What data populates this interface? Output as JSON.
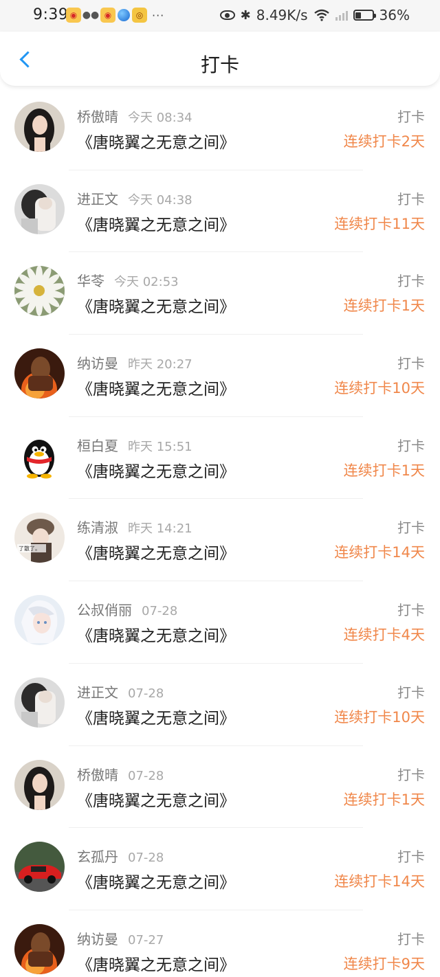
{
  "status_bar": {
    "time": "9:39",
    "network_speed": "8.49K/s",
    "battery": "36%",
    "battery_level": 0.36,
    "more_dots": "···",
    "icons": [
      "weibo-icon",
      "wechat-icon",
      "weibo-icon",
      "globe-icon",
      "app-icon",
      "eye-icon",
      "bluetooth-icon",
      "wifi-icon",
      "signal-icon",
      "battery-icon"
    ]
  },
  "header": {
    "title": "打卡",
    "back_icon": "chevron-left-icon"
  },
  "colors": {
    "accent": "#2196f3",
    "streak": "#f0874a",
    "name": "#777777",
    "time": "#a8a8a8",
    "divider": "#efefef"
  },
  "list": {
    "items": [
      {
        "name": "桥傲晴",
        "time": "今天 08:34",
        "book": "《唐晓翼之无意之间》",
        "tag": "打卡",
        "streak": "连续打卡2天",
        "avatar": "girl-portrait"
      },
      {
        "name": "进正文",
        "time": "今天 04:38",
        "book": "《唐晓翼之无意之间》",
        "tag": "打卡",
        "streak": "连续打卡11天",
        "avatar": "girl-hiding-face"
      },
      {
        "name": "华苓",
        "time": "今天 02:53",
        "book": "《唐晓翼之无意之间》",
        "tag": "打卡",
        "streak": "连续打卡1天",
        "avatar": "white-daisy"
      },
      {
        "name": "纳访曼",
        "time": "昨天 20:27",
        "book": "《唐晓翼之无意之间》",
        "tag": "打卡",
        "streak": "连续打卡10天",
        "avatar": "game-warrior"
      },
      {
        "name": "桓白夏",
        "time": "昨天 15:51",
        "book": "《唐晓翼之无意之间》",
        "tag": "打卡",
        "streak": "连续打卡1天",
        "avatar": "qq-penguin"
      },
      {
        "name": "练清淑",
        "time": "昨天 14:21",
        "book": "《唐晓翼之无意之间》",
        "tag": "打卡",
        "streak": "连续打卡14天",
        "avatar": "girl-with-hat",
        "avatar_caption": "了散了。"
      },
      {
        "name": "公叔俏丽",
        "time": "07-28",
        "book": "《唐晓翼之无意之间》",
        "tag": "打卡",
        "streak": "连续打卡4天",
        "avatar": "anime-white-hair"
      },
      {
        "name": "进正文",
        "time": "07-28",
        "book": "《唐晓翼之无意之间》",
        "tag": "打卡",
        "streak": "连续打卡10天",
        "avatar": "girl-hiding-face"
      },
      {
        "name": "桥傲晴",
        "time": "07-28",
        "book": "《唐晓翼之无意之间》",
        "tag": "打卡",
        "streak": "连续打卡1天",
        "avatar": "girl-portrait"
      },
      {
        "name": "玄孤丹",
        "time": "07-28",
        "book": "《唐晓翼之无意之间》",
        "tag": "打卡",
        "streak": "连续打卡14天",
        "avatar": "red-sports-car"
      },
      {
        "name": "纳访曼",
        "time": "07-27",
        "book": "《唐晓翼之无意之间》",
        "tag": "打卡",
        "streak": "连续打卡9天",
        "avatar": "game-warrior"
      }
    ]
  }
}
